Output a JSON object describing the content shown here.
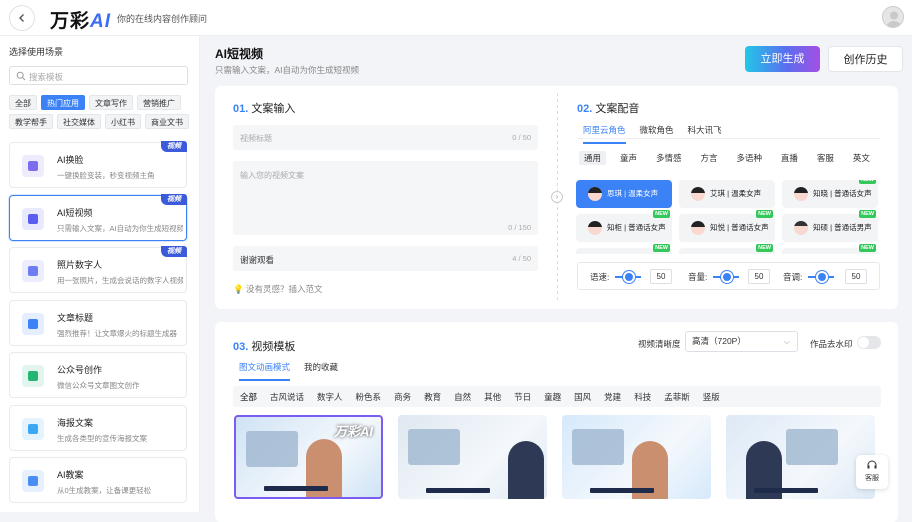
{
  "header": {
    "logo_text": "万彩",
    "logo_ai": "AI",
    "slogan": "你的在线内容创作顾问"
  },
  "sidebar": {
    "title": "选择使用场景",
    "search_placeholder": "搜索模板",
    "tags": [
      {
        "label": "全部",
        "active": false
      },
      {
        "label": "热门应用",
        "active": true
      },
      {
        "label": "文章写作",
        "active": false
      },
      {
        "label": "营销推广",
        "active": false
      },
      {
        "label": "教学帮手",
        "active": false
      },
      {
        "label": "社交媒体",
        "active": false
      },
      {
        "label": "小红书",
        "active": false
      },
      {
        "label": "商业文书",
        "active": false
      }
    ],
    "cards": [
      {
        "title": "AI换脸",
        "desc": "一键换脸变装，秒变视频主角",
        "badge": "视频",
        "icon": "face-swap-icon",
        "color": "#7c6cf0"
      },
      {
        "title": "AI短视频",
        "desc": "只需输入文案，AI自动为你生成短视频",
        "badge": "视频",
        "icon": "video-bowtie-icon",
        "color": "#5b5cf0",
        "selected": true
      },
      {
        "title": "照片数字人",
        "desc": "用一张照片，生成会说话的数字人视频",
        "badge": "视频",
        "icon": "digital-human-icon",
        "color": "#6f7df5"
      },
      {
        "title": "文章标题",
        "desc": "强烈推荐！让文章爆火的标题生成器",
        "badge": "",
        "icon": "title-icon",
        "color": "#3b82f6"
      },
      {
        "title": "公众号创作",
        "desc": "微信公众号文章图文创作",
        "badge": "",
        "icon": "wechat-icon",
        "color": "#22b573"
      },
      {
        "title": "海报文案",
        "desc": "生成各类型的宣传海报文案",
        "badge": "",
        "icon": "poster-icon",
        "color": "#3ba7f5"
      },
      {
        "title": "AI教案",
        "desc": "从0生成教案，让备课更轻松",
        "badge": "",
        "icon": "graduation-cap-icon",
        "color": "#4a8df5"
      }
    ]
  },
  "main": {
    "title": "AI短视频",
    "subtitle": "只需输入文案，AI自动为你生成短视频",
    "generate_label": "立即生成",
    "history_label": "创作历史"
  },
  "text_input": {
    "num": "01.",
    "title": "文案输入",
    "title_placeholder": "视频标题",
    "title_count": "0 / 50",
    "body_placeholder": "输入您的视频文案",
    "body_count": "0 / 150",
    "ending_value": "谢谢观看",
    "ending_count": "4 / 50",
    "inspire": "没有灵感？插入范文"
  },
  "voice": {
    "num": "02.",
    "title": "文案配音",
    "providers": [
      {
        "label": "阿里云角色",
        "active": true
      },
      {
        "label": "微软角色",
        "active": false
      },
      {
        "label": "科大讯飞",
        "active": false
      }
    ],
    "types": [
      {
        "label": "通用",
        "active": true
      },
      {
        "label": "童声",
        "active": false
      },
      {
        "label": "多情感",
        "active": false
      },
      {
        "label": "方言",
        "active": false
      },
      {
        "label": "多语种",
        "active": false
      },
      {
        "label": "直播",
        "active": false
      },
      {
        "label": "客服",
        "active": false
      },
      {
        "label": "英文",
        "active": false
      }
    ],
    "voices": [
      {
        "label": "思琪 | 温柔女声",
        "active": true,
        "new": false,
        "male": false
      },
      {
        "label": "艾琪 | 温柔女声",
        "active": false,
        "new": false,
        "male": false
      },
      {
        "label": "知晓 | 普通话女声",
        "active": false,
        "new": true,
        "male": false
      },
      {
        "label": "知柜 | 普通话女声",
        "active": false,
        "new": true,
        "male": false
      },
      {
        "label": "知悦 | 普通话女声",
        "active": false,
        "new": true,
        "male": false
      },
      {
        "label": "知硕 | 普通话男声",
        "active": false,
        "new": true,
        "male": true
      },
      {
        "label": "",
        "active": false,
        "new": true,
        "male": false
      },
      {
        "label": "",
        "active": false,
        "new": true,
        "male": false
      },
      {
        "label": "",
        "active": false,
        "new": true,
        "male": false
      }
    ],
    "speed_label": "语速:",
    "speed_value": "50",
    "volume_label": "音量:",
    "volume_value": "50",
    "pitch_label": "音调:",
    "pitch_value": "50"
  },
  "template": {
    "num": "03.",
    "title": "视频模板",
    "tabs": [
      {
        "label": "图文动画模式",
        "active": true
      },
      {
        "label": "我的收藏",
        "active": false
      }
    ],
    "quality_label": "视频清晰度",
    "quality_value": "高清（720P）",
    "watermark_label": "作品去水印",
    "categories": [
      "全部",
      "古风说话",
      "数字人",
      "粉色系",
      "商务",
      "教育",
      "自然",
      "其他",
      "节日",
      "童趣",
      "国风",
      "党建",
      "科技",
      "孟菲斯",
      "竖版"
    ],
    "thumbs": [
      {
        "bg": "#cfe3f5",
        "selected": true,
        "logo": "万彩AI"
      },
      {
        "bg": "#dfe8f0",
        "selected": false,
        "logo": ""
      },
      {
        "bg": "#d6e9fb",
        "selected": false,
        "logo": ""
      },
      {
        "bg": "#dde9f6",
        "selected": false,
        "logo": ""
      }
    ]
  },
  "float": {
    "label": "客服"
  }
}
